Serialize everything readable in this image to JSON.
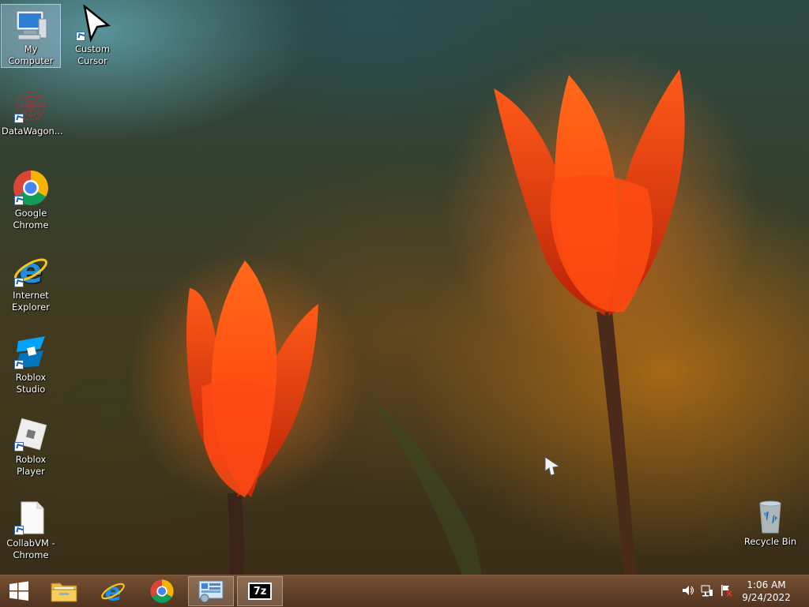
{
  "desktop": {
    "icons": [
      {
        "label": "My Computer",
        "icon": "computer-icon",
        "selected": true
      },
      {
        "label": "Custom Cursor",
        "icon": "cursor-arrow-icon"
      },
      {
        "label": "DataWagon...",
        "icon": "datawagon-icon"
      },
      {
        "label": "Google Chrome",
        "icon": "chrome-icon"
      },
      {
        "label": "Internet Explorer",
        "icon": "internet-explorer-icon"
      },
      {
        "label": "Roblox Studio",
        "icon": "roblox-studio-icon"
      },
      {
        "label": "Roblox Player",
        "icon": "roblox-player-icon"
      },
      {
        "label": "CollabVM - Chrome",
        "icon": "blank-document-icon"
      },
      {
        "label": "Recycle Bin",
        "icon": "recycle-bin-icon"
      }
    ]
  },
  "taskbar": {
    "start": "windows-logo-icon",
    "pinned": [
      {
        "icon": "file-explorer-icon"
      },
      {
        "icon": "internet-explorer-icon"
      },
      {
        "icon": "chrome-icon"
      },
      {
        "icon": "control-panel-icon",
        "active": true
      },
      {
        "icon": "7zip-icon",
        "text": "7z",
        "active": true
      }
    ],
    "tray": [
      "volume-icon",
      "network-icon",
      "action-center-flag-icon"
    ],
    "clock": {
      "time": "1:06 AM",
      "date": "9/24/2022"
    }
  },
  "colors": {
    "taskbar": "#5a3720",
    "selection": "#b4d2f0",
    "chrome_red": "#db4437",
    "chrome_green": "#0f9d58",
    "chrome_yellow": "#f4b400",
    "chrome_blue": "#4285f4",
    "ie_blue": "#1e90e0"
  }
}
